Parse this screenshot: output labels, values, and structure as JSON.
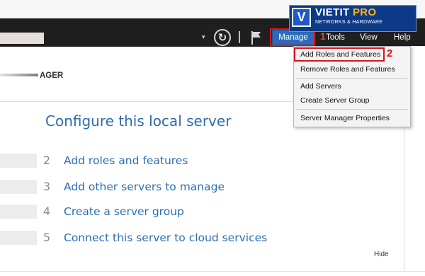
{
  "logo": {
    "brand_main": "VIETIT",
    "brand_accent": "PRO",
    "tagline": "NETWORKS & HARDWARE",
    "mark": "V"
  },
  "menubar": {
    "items": [
      {
        "label": "Manage"
      },
      {
        "label": "Tools"
      },
      {
        "label": "View"
      },
      {
        "label": "Help"
      }
    ],
    "step_marker": "1",
    "accent_color": "#2b6bba"
  },
  "manage_menu": {
    "items": [
      {
        "label": "Add Roles and Features"
      },
      {
        "label": "Remove Roles and Features"
      },
      {
        "label": "Add Servers"
      },
      {
        "label": "Create Server Group"
      },
      {
        "label": "Server Manager Properties"
      }
    ],
    "step_marker": "2",
    "highlight_color": "#d4151b"
  },
  "header": {
    "title_fragment": "AGER"
  },
  "welcome": {
    "title": "Configure this local server",
    "steps": [
      {
        "number": "2",
        "label": "Add roles and features"
      },
      {
        "number": "3",
        "label": "Add other servers to manage"
      },
      {
        "number": "4",
        "label": "Create a server group"
      },
      {
        "number": "5",
        "label": "Connect this server to cloud services"
      }
    ],
    "hide_label": "Hide",
    "link_color": "#2c6db0"
  },
  "icons": [
    "refresh-icon",
    "flag-icon",
    "dropdown-arrow-icon"
  ]
}
